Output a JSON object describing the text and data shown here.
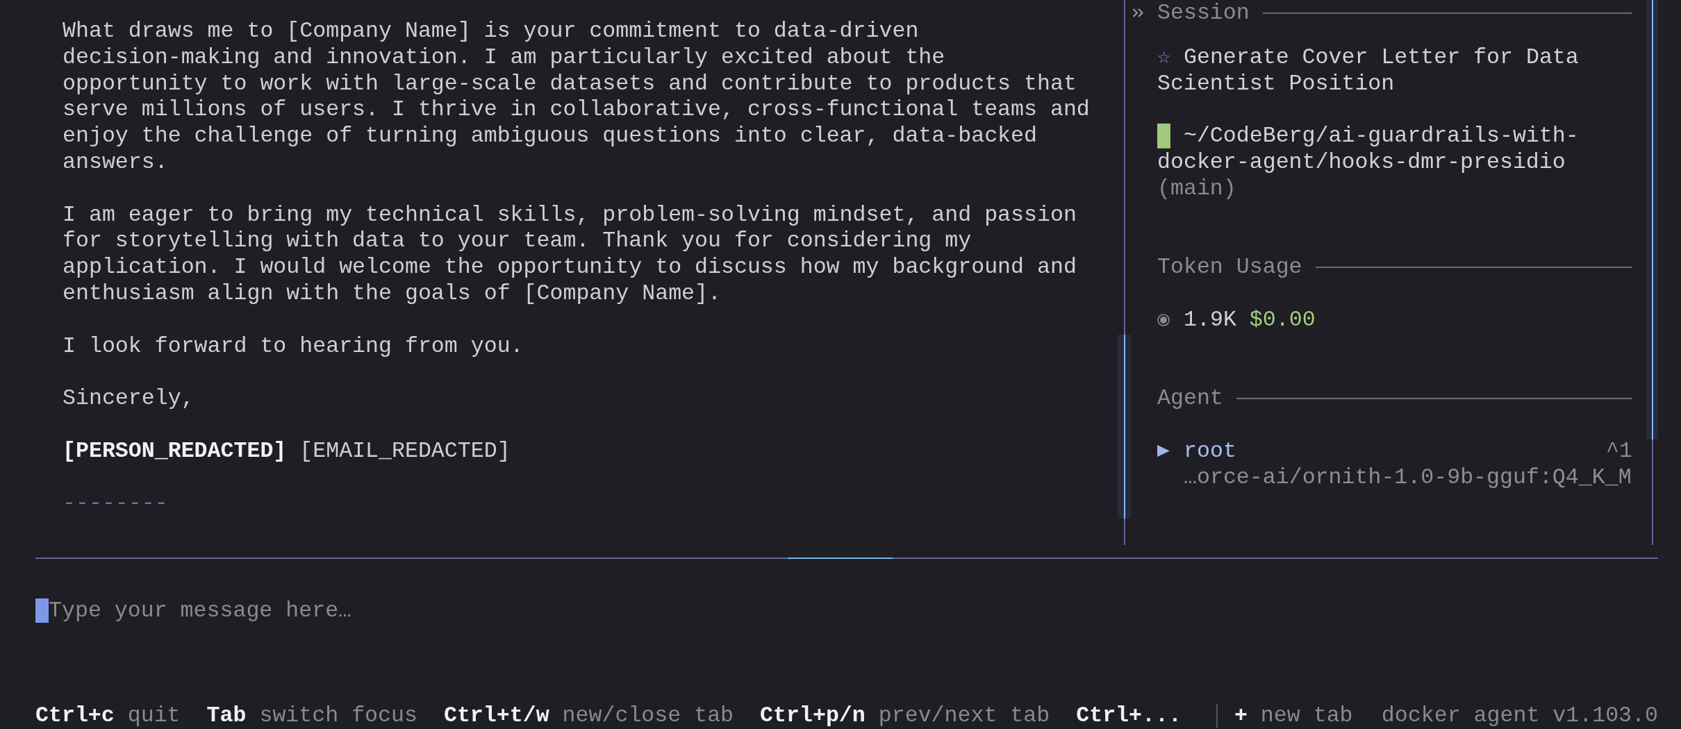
{
  "chat": {
    "blocks": [
      {
        "kind": "text",
        "lines": [
          "What draws me to [Company Name] is your commitment to data-driven",
          "decision-making and innovation. I am particularly excited about the",
          "opportunity to work with large-scale datasets and contribute to products that",
          "serve millions of users. I thrive in collaborative, cross-functional teams and",
          "enjoy the challenge of turning ambiguous questions into clear, data-backed",
          "answers."
        ]
      },
      {
        "kind": "text",
        "lines": [
          "I am eager to bring my technical skills, problem-solving mindset, and passion",
          "for storytelling with data to your team. Thank you for considering my",
          "application. I would welcome the opportunity to discuss how my background and",
          "enthusiasm align with the goals of [Company Name]."
        ]
      },
      {
        "kind": "text",
        "lines": [
          "I look forward to hearing from you."
        ]
      },
      {
        "kind": "text",
        "lines": [
          "Sincerely,"
        ]
      },
      {
        "kind": "signature",
        "text": "**[PERSON_REDACTED]** [EMAIL_REDACTED]"
      },
      {
        "kind": "rule",
        "text": "--------"
      }
    ]
  },
  "sidebar": {
    "session": {
      "heading": "Session",
      "title": "☆ Generate Cover Letter for Data Scientist Position",
      "path": "█ ~/CodeBerg/ai-guardrails-with-docker-agent/hooks-dmr-presidio",
      "branch": "(main)"
    },
    "token_usage": {
      "heading": "Token Usage",
      "tokens": "1.9K",
      "cost": "$0.00"
    },
    "agent": {
      "heading": "Agent",
      "agents": [
        {
          "name": "root",
          "selected": true,
          "shortcut": "^1",
          "model": "…orce-ai/ornith-1.0-9b-gguf:Q4_K_M"
        }
      ]
    }
  },
  "input": {
    "placeholder": "Type your message here…"
  },
  "status_bar": {
    "shortcuts": [
      {
        "key": "Ctrl+c",
        "action": "quit"
      },
      {
        "key": "Tab",
        "action": "switch focus"
      },
      {
        "key": "Ctrl+t/w",
        "action": "new/close tab"
      },
      {
        "key": "Ctrl+p/n",
        "action": "prev/next tab"
      },
      {
        "key": "Ctrl+..."
      }
    ],
    "new_tab": {
      "key": "+",
      "label": "new tab"
    },
    "version": "docker agent v1.103.0"
  }
}
